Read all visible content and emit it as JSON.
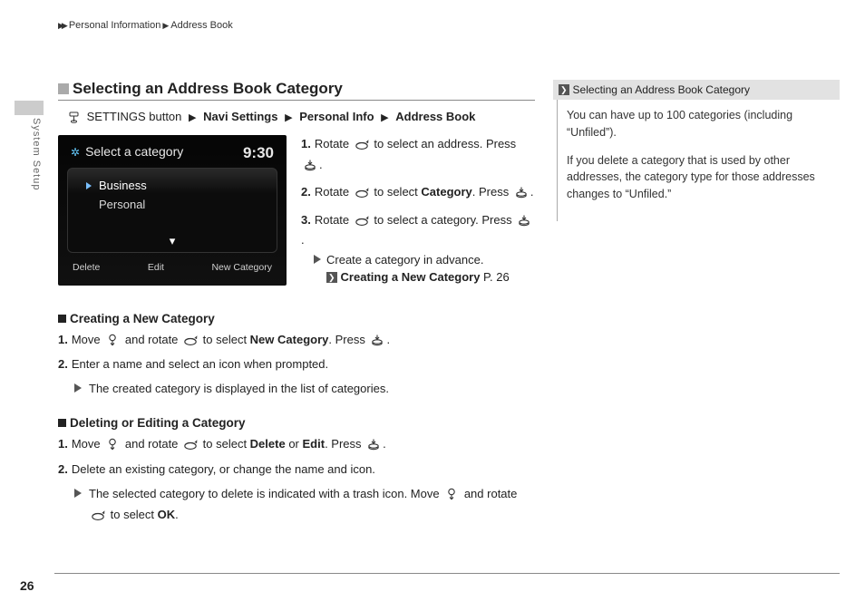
{
  "breadcrumb": {
    "a": "Personal Information",
    "b": "Address Book"
  },
  "side_label": "System Setup",
  "section_title": "Selecting an Address Book Category",
  "nav_path": {
    "p0": "SETTINGS button",
    "p1": "Navi Settings",
    "p2": "Personal Info",
    "p3": "Address Book"
  },
  "screenshot": {
    "header": "Select a category",
    "clock": "9:30",
    "items": [
      "Business",
      "Personal"
    ],
    "footer": [
      "Delete",
      "Edit",
      "New Category"
    ]
  },
  "steps_right": {
    "s1a": "Rotate ",
    "s1b": " to select an address. Press ",
    "s1c": ".",
    "s2a": "Rotate ",
    "s2b": " to select ",
    "s2c": "Category",
    "s2d": ". Press ",
    "s2e": ".",
    "s3a": "Rotate ",
    "s3b": " to select a category. Press ",
    "s3c": ".",
    "note": "Create a category in advance.",
    "ref": "Creating a New Category",
    "ref_page": "P. 26"
  },
  "sub1": {
    "title": "Creating a New Category",
    "l1a": "Move ",
    "l1b": " and rotate ",
    "l1c": " to select ",
    "l1d": "New Category",
    "l1e": ". Press ",
    "l1f": ".",
    "l2": "Enter a name and select an icon when prompted.",
    "note": "The created category is displayed in the list of categories."
  },
  "sub2": {
    "title": "Deleting or Editing a Category",
    "l1a": "Move ",
    "l1b": " and rotate ",
    "l1c": " to select ",
    "l1d": "Delete",
    "l1e": " or ",
    "l1f": "Edit",
    "l1g": ". Press ",
    "l1h": ".",
    "l2": "Delete an existing category, or change the name and icon.",
    "note_a": "The selected category to delete is indicated with a trash icon. Move ",
    "note_b": " and rotate ",
    "note_c": " to select ",
    "note_d": "OK",
    "note_e": "."
  },
  "sidebar": {
    "head": "Selecting an Address Book Category",
    "p1": "You can have up to 100 categories (including “Unfiled”).",
    "p2": "If you delete a category that is used by other addresses, the category type for those addresses changes to “Unfiled.”"
  },
  "page_number": "26"
}
